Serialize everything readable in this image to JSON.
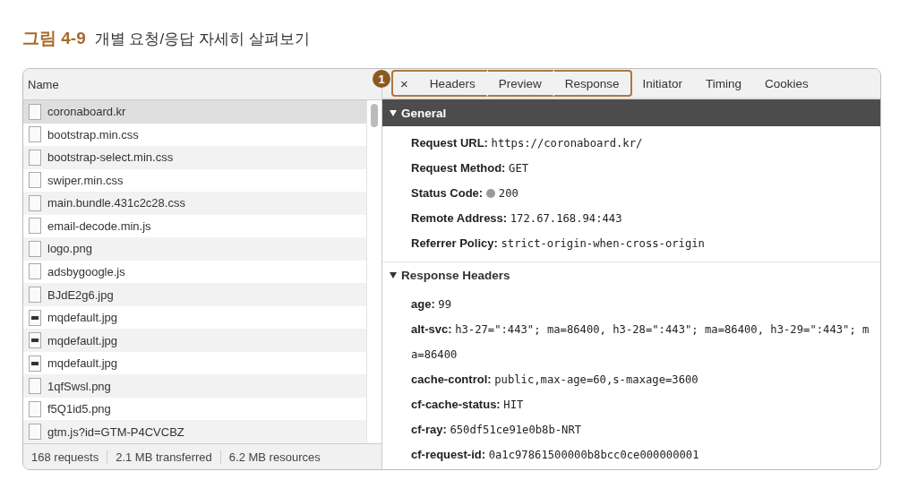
{
  "figure": {
    "number": "그림 4-9",
    "caption": "개별 요청/응답 자세히 살펴보기"
  },
  "requests": {
    "column": "Name",
    "rows": [
      {
        "name": "coronaboard.kr",
        "kind": "doc",
        "selected": true
      },
      {
        "name": "bootstrap.min.css",
        "kind": "doc",
        "selected": false
      },
      {
        "name": "bootstrap-select.min.css",
        "kind": "doc",
        "selected": false
      },
      {
        "name": "swiper.min.css",
        "kind": "doc",
        "selected": false
      },
      {
        "name": "main.bundle.431c2c28.css",
        "kind": "doc",
        "selected": false
      },
      {
        "name": "email-decode.min.js",
        "kind": "doc",
        "selected": false
      },
      {
        "name": "logo.png",
        "kind": "doc",
        "selected": false
      },
      {
        "name": "adsbygoogle.js",
        "kind": "doc",
        "selected": false
      },
      {
        "name": "BJdE2g6.jpg",
        "kind": "doc",
        "selected": false
      },
      {
        "name": "mqdefault.jpg",
        "kind": "image",
        "selected": false
      },
      {
        "name": "mqdefault.jpg",
        "kind": "image",
        "selected": false
      },
      {
        "name": "mqdefault.jpg",
        "kind": "image",
        "selected": false
      },
      {
        "name": "1qfSwsl.png",
        "kind": "doc",
        "selected": false
      },
      {
        "name": "f5Q1id5.png",
        "kind": "doc",
        "selected": false
      },
      {
        "name": "gtm.js?id=GTM-P4CVCBZ",
        "kind": "doc",
        "selected": false
      }
    ],
    "status": [
      "168 requests",
      "2.1 MB transferred",
      "6.2 MB resources"
    ]
  },
  "details": {
    "close": "×",
    "callout": "1",
    "tabs": [
      {
        "label": "Headers",
        "highlighted": true
      },
      {
        "label": "Preview",
        "highlighted": true
      },
      {
        "label": "Response",
        "highlighted": true
      },
      {
        "label": "Initiator",
        "highlighted": false
      },
      {
        "label": "Timing",
        "highlighted": false
      },
      {
        "label": "Cookies",
        "highlighted": false
      }
    ],
    "sections": [
      {
        "title": "General",
        "kind": "dark",
        "expanded": true,
        "fields": [
          {
            "key": "Request URL:",
            "value": "https://coronaboard.kr/"
          },
          {
            "key": "Request Method:",
            "value": "GET"
          },
          {
            "key": "Status Code:",
            "value": "200",
            "color": "#9a9a9a"
          },
          {
            "key": "Remote Address:",
            "value": "172.67.168.94:443"
          },
          {
            "key": "Referrer Policy:",
            "value": "strict-origin-when-cross-origin"
          }
        ]
      },
      {
        "title": "Response Headers",
        "kind": "light",
        "expanded": true,
        "fields": [
          {
            "key": "age:",
            "value": "99"
          },
          {
            "key": "alt-svc:",
            "value": "h3-27=\":443\"; ma=86400, h3-28=\":443\"; ma=86400, h3-29=\":443\"; ma=86400"
          },
          {
            "key": "cache-control:",
            "value": "public,max-age=60,s-maxage=3600"
          },
          {
            "key": "cf-cache-status:",
            "value": "HIT"
          },
          {
            "key": "cf-ray:",
            "value": "650df51ce91e0b8b-NRT"
          },
          {
            "key": "cf-request-id:",
            "value": "0a1c97861500000b8bcc0ce000000001"
          }
        ]
      }
    ]
  }
}
